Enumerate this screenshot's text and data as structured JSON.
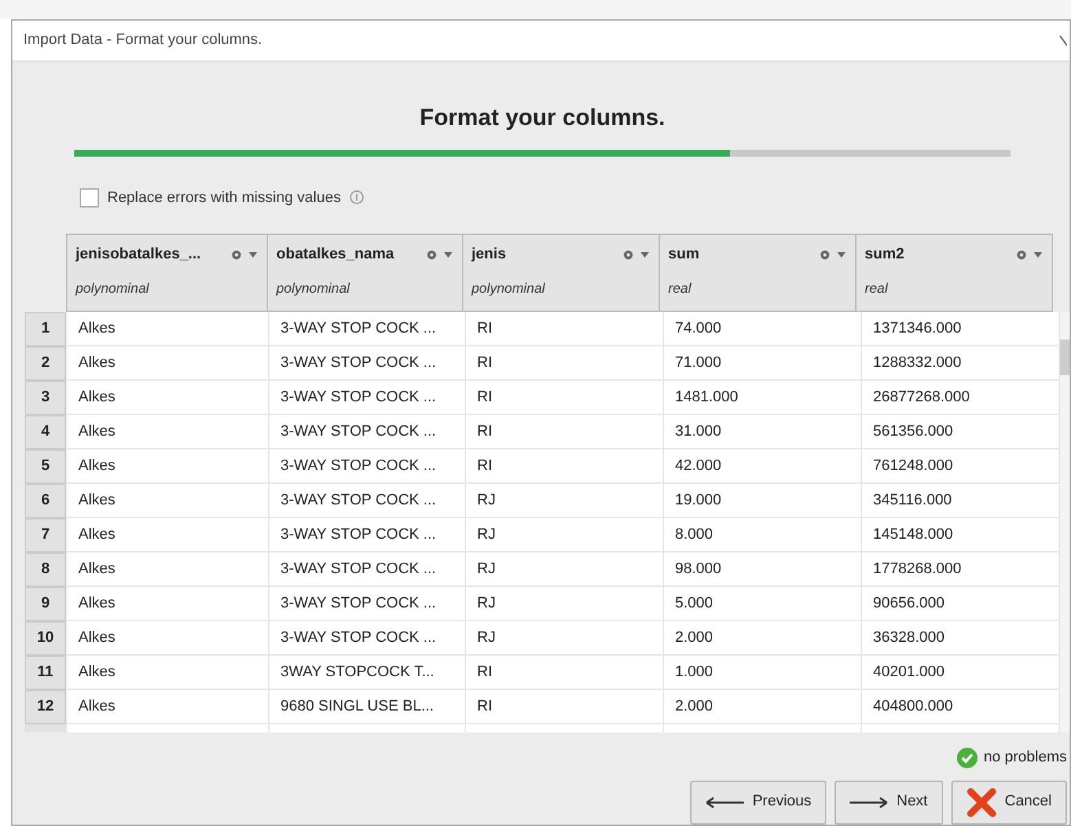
{
  "window": {
    "title": "Import Data - Format your columns."
  },
  "heading": "Format your columns.",
  "progress": {
    "level": 0.7
  },
  "replace_errors": {
    "label": "Replace errors with missing values",
    "checked": false
  },
  "table": {
    "columns": [
      {
        "name": "jenisobatalkes_...",
        "type": "polynominal"
      },
      {
        "name": "obatalkes_nama",
        "type": "polynominal"
      },
      {
        "name": "jenis",
        "type": "polynominal"
      },
      {
        "name": "sum",
        "type": "real"
      },
      {
        "name": "sum2",
        "type": "real"
      }
    ],
    "rows": [
      {
        "index": "1",
        "cells": [
          "Alkes",
          "3-WAY STOP COCK ...",
          "RI",
          "74.000",
          "1371346.000"
        ]
      },
      {
        "index": "2",
        "cells": [
          "Alkes",
          "3-WAY STOP COCK ...",
          "RI",
          "71.000",
          "1288332.000"
        ]
      },
      {
        "index": "3",
        "cells": [
          "Alkes",
          "3-WAY STOP COCK ...",
          "RI",
          "1481.000",
          "26877268.000"
        ]
      },
      {
        "index": "4",
        "cells": [
          "Alkes",
          "3-WAY STOP COCK ...",
          "RI",
          "31.000",
          "561356.000"
        ]
      },
      {
        "index": "5",
        "cells": [
          "Alkes",
          "3-WAY STOP COCK ...",
          "RI",
          "42.000",
          "761248.000"
        ]
      },
      {
        "index": "6",
        "cells": [
          "Alkes",
          "3-WAY STOP COCK ...",
          "RJ",
          "19.000",
          "345116.000"
        ]
      },
      {
        "index": "7",
        "cells": [
          "Alkes",
          "3-WAY STOP COCK ...",
          "RJ",
          "8.000",
          "145148.000"
        ]
      },
      {
        "index": "8",
        "cells": [
          "Alkes",
          "3-WAY STOP COCK ...",
          "RJ",
          "98.000",
          "1778268.000"
        ]
      },
      {
        "index": "9",
        "cells": [
          "Alkes",
          "3-WAY STOP COCK ...",
          "RJ",
          "5.000",
          "90656.000"
        ]
      },
      {
        "index": "10",
        "cells": [
          "Alkes",
          "3-WAY STOP COCK ...",
          "RJ",
          "2.000",
          "36328.000"
        ]
      },
      {
        "index": "11",
        "cells": [
          "Alkes",
          "3WAY STOPCOCK T...",
          "RI",
          "1.000",
          "40201.000"
        ]
      },
      {
        "index": "12",
        "cells": [
          "Alkes",
          "9680 SINGL USE BL...",
          "RI",
          "2.000",
          "404800.000"
        ]
      }
    ]
  },
  "status": {
    "kind": "ok",
    "text": "no problems"
  },
  "buttons": [
    {
      "kind": "previous",
      "label": "Previous"
    },
    {
      "kind": "next",
      "label": "Next"
    },
    {
      "kind": "cancel",
      "label": "Cancel"
    }
  ]
}
